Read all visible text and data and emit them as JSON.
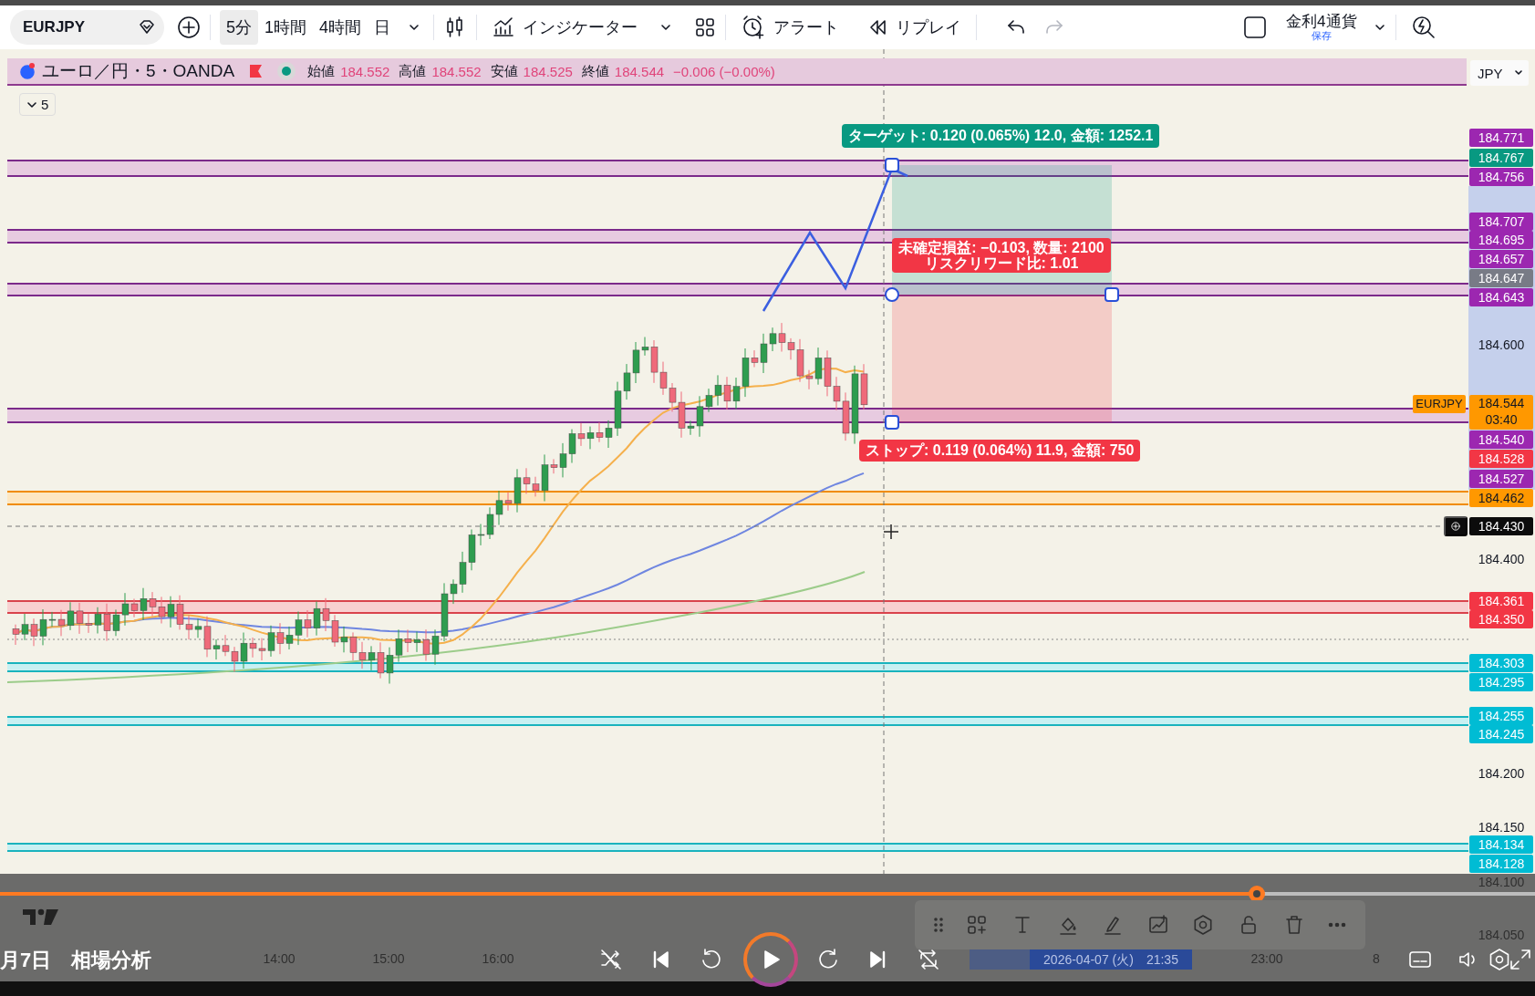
{
  "toolbar": {
    "symbol": "EURJPY",
    "intervals": [
      {
        "label": "5分",
        "selected": true
      },
      {
        "label": "1時間",
        "selected": false
      },
      {
        "label": "4時間",
        "selected": false
      },
      {
        "label": "日",
        "selected": false
      }
    ],
    "indicators": "インジケーター",
    "alert": "アラート",
    "replay": "リプレイ",
    "redo": {
      "disabled": true
    },
    "layout_checkbox": {
      "checked": false
    },
    "layout": {
      "name": "金利4通貨",
      "status": "保存"
    }
  },
  "legend": {
    "title": "ユーロ／円・5・OANDA",
    "values": [
      {
        "label": "始値",
        "value": "184.552"
      },
      {
        "label": "高値",
        "value": "184.552"
      },
      {
        "label": "安値",
        "value": "184.525"
      },
      {
        "label": "終値",
        "value": "184.544"
      }
    ],
    "change": "−0.006 (−0.00%)",
    "collapse": "5"
  },
  "currency": "JPY",
  "position": {
    "target": "ターゲット: 0.120 (0.065%) 12.0, 金額: 1252.1",
    "pnl": [
      "未確定損益: −0.103, 数量: 2100",
      "リスクリワード比: 1.01"
    ],
    "stop": "ストップ: 0.119 (0.064%) 11.9, 金額: 750"
  },
  "price_axis": [
    {
      "text": "184.771",
      "kind": "tag",
      "color": "#9c27b0"
    },
    {
      "text": "184.767",
      "kind": "tag",
      "color": "#089981"
    },
    {
      "text": "184.756",
      "kind": "tag",
      "color": "#9c27b0"
    },
    {
      "text": "184.707",
      "kind": "tag",
      "color": "#9c27b0"
    },
    {
      "text": "184.695",
      "kind": "tag",
      "color": "#9c27b0"
    },
    {
      "text": "184.657",
      "kind": "tag",
      "color": "#9c27b0"
    },
    {
      "text": "184.647",
      "kind": "tag",
      "color": "#787b86"
    },
    {
      "text": "184.643",
      "kind": "tag",
      "color": "#9c27b0"
    },
    {
      "text": "184.600",
      "kind": "tick"
    },
    {
      "text": "184.544",
      "kind": "last",
      "color": "#ff9800",
      "countdown": "03:40",
      "symbol": "EURJPY"
    },
    {
      "text": "184.540",
      "kind": "tag",
      "color": "#9c27b0"
    },
    {
      "text": "184.528",
      "kind": "tag",
      "color": "#f23645"
    },
    {
      "text": "184.527",
      "kind": "tag",
      "color": "#9c27b0"
    },
    {
      "text": "184.462",
      "kind": "tag",
      "color": "#ff9800"
    },
    {
      "text": "184.430",
      "kind": "crosshair"
    },
    {
      "text": "184.400",
      "kind": "tick"
    },
    {
      "text": "184.361",
      "kind": "tag",
      "color": "#f23645"
    },
    {
      "text": "184.350",
      "kind": "tag",
      "color": "#f23645"
    },
    {
      "text": "184.303",
      "kind": "tag",
      "color": "#00bcd4"
    },
    {
      "text": "184.295",
      "kind": "tag",
      "color": "#00bcd4"
    },
    {
      "text": "184.255",
      "kind": "tag",
      "color": "#00bcd4"
    },
    {
      "text": "184.245",
      "kind": "tag",
      "color": "#00bcd4"
    },
    {
      "text": "184.200",
      "kind": "tick"
    },
    {
      "text": "184.150",
      "kind": "tick"
    },
    {
      "text": "184.134",
      "kind": "tag",
      "color": "#00bcd4"
    },
    {
      "text": "184.128",
      "kind": "tag",
      "color": "#00bcd4"
    },
    {
      "text": "184.100",
      "kind": "tick"
    },
    {
      "text": "184.050",
      "kind": "tick"
    }
  ],
  "time_axis": [
    {
      "text": "14:00",
      "kind": "tick"
    },
    {
      "text": "15:00",
      "kind": "tick"
    },
    {
      "text": "16:00",
      "kind": "tick"
    },
    {
      "text": "2026-04-07 (火)　21:35",
      "kind": "cursor"
    },
    {
      "text": "23:00",
      "kind": "tick"
    },
    {
      "text": "8",
      "kind": "tick"
    }
  ],
  "video": {
    "caption": "月7日　相場分析",
    "level": 0.819,
    "playing": false
  }
}
